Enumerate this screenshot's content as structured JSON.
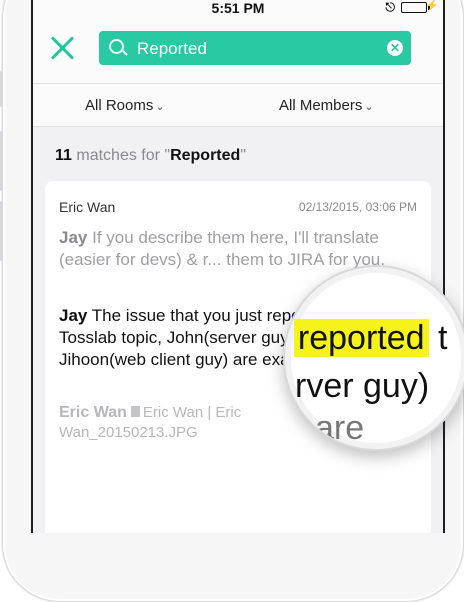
{
  "status_bar": {
    "time": "5:51 PM",
    "lock_icon": "rotation-lock-icon",
    "battery_icon": "battery-charging-icon"
  },
  "search": {
    "query": "Reported",
    "placeholder": "Search"
  },
  "filters": {
    "rooms": "All Rooms",
    "members": "All Members"
  },
  "results": {
    "count": "11",
    "text_mid": " matches for \"",
    "query": "Reported",
    "text_end": "\""
  },
  "card": {
    "sender": "Eric Wan",
    "date": "02/13/2015, 03:06 PM",
    "msg1_who": "Jay",
    "msg1_text": " If you describe them here, I'll translate (easier for devs) & r... them to JIRA for you.",
    "msg2_who": "Jay",
    "msg2_text": " The issue that you just reported to the Tosslab topic, John(server guy) and Jihoon(web client guy) are examining it now.",
    "file_sender": "Eric Wan",
    "file_name": "Eric Wan | Eric Wan_20150213.JPG"
  },
  "magnifier": {
    "pre": "t ",
    "highlight": "reported",
    "post": " t",
    "line2": "rver guy)",
    "line3": "are"
  },
  "colors": {
    "accent": "#28c9a3",
    "highlight": "#f6f31a"
  }
}
